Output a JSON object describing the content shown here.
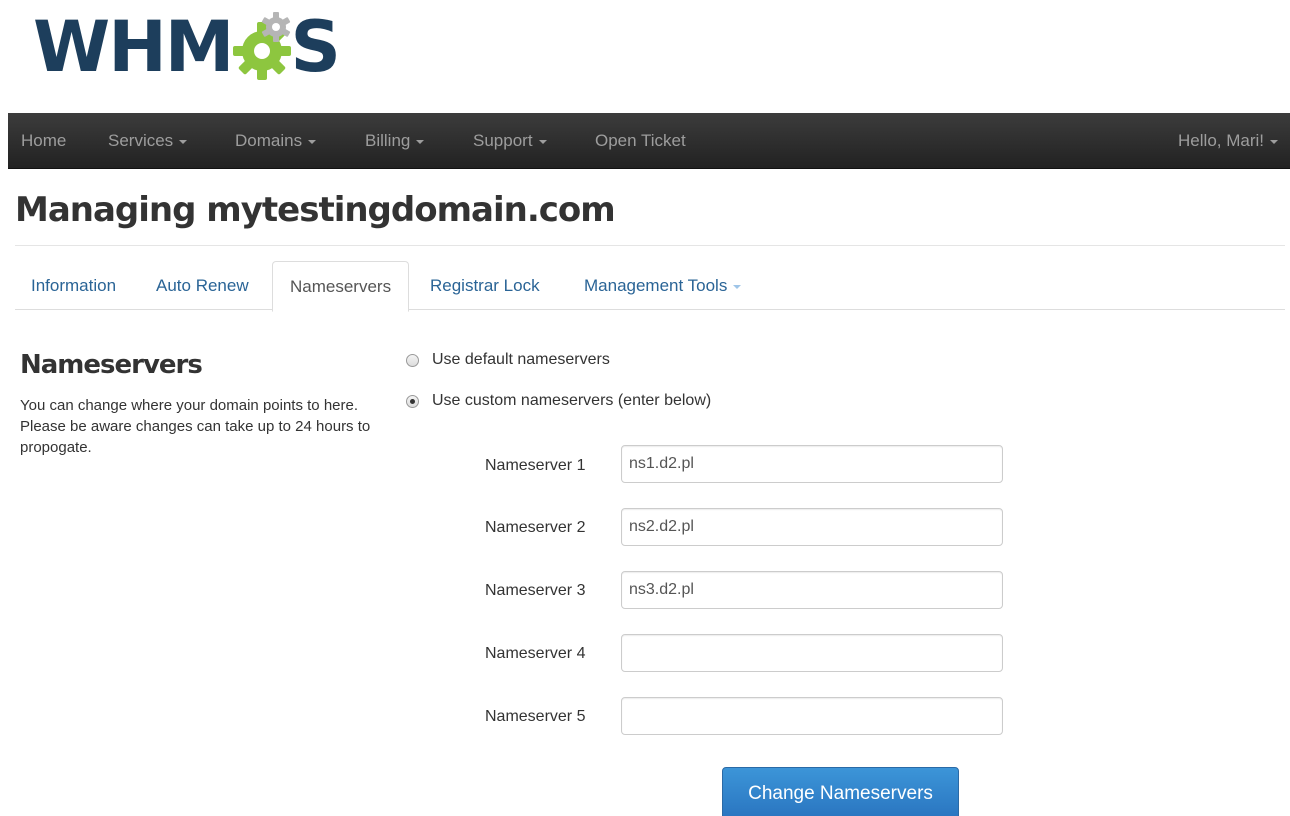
{
  "logo": {
    "text_left": "WHM",
    "text_right": "S",
    "gear_colors": [
      "#8dc63f",
      "#b5b5b5"
    ]
  },
  "navbar": {
    "items": [
      {
        "label": "Home",
        "has_caret": false
      },
      {
        "label": "Services",
        "has_caret": true
      },
      {
        "label": "Domains",
        "has_caret": true
      },
      {
        "label": "Billing",
        "has_caret": true
      },
      {
        "label": "Support",
        "has_caret": true
      },
      {
        "label": "Open Ticket",
        "has_caret": false
      }
    ],
    "user_greeting": "Hello, Mari!"
  },
  "page": {
    "title": "Managing mytestingdomain.com"
  },
  "tabs": [
    {
      "label": "Information"
    },
    {
      "label": "Auto Renew"
    },
    {
      "label": "Nameservers",
      "active": true
    },
    {
      "label": "Registrar Lock"
    },
    {
      "label": "Management Tools",
      "has_caret": true
    }
  ],
  "section": {
    "heading": "Nameservers",
    "description": "You can change where your domain points to here. Please be aware changes can take up to 24 hours to propogate."
  },
  "options": [
    {
      "label": "Use default nameservers",
      "checked": false
    },
    {
      "label": "Use custom nameservers (enter below)",
      "checked": true
    }
  ],
  "nameservers": [
    {
      "label": "Nameserver 1",
      "value": "ns1.d2.pl"
    },
    {
      "label": "Nameserver 2",
      "value": "ns2.d2.pl"
    },
    {
      "label": "Nameserver 3",
      "value": "ns3.d2.pl"
    },
    {
      "label": "Nameserver 4",
      "value": ""
    },
    {
      "label": "Nameserver 5",
      "value": ""
    }
  ],
  "submit_label": "Change Nameservers",
  "colors": {
    "navbar": "#2a2a2a",
    "link": "#2a6496",
    "logo_blue": "#1d3e5c",
    "button": "#2a75c0"
  }
}
